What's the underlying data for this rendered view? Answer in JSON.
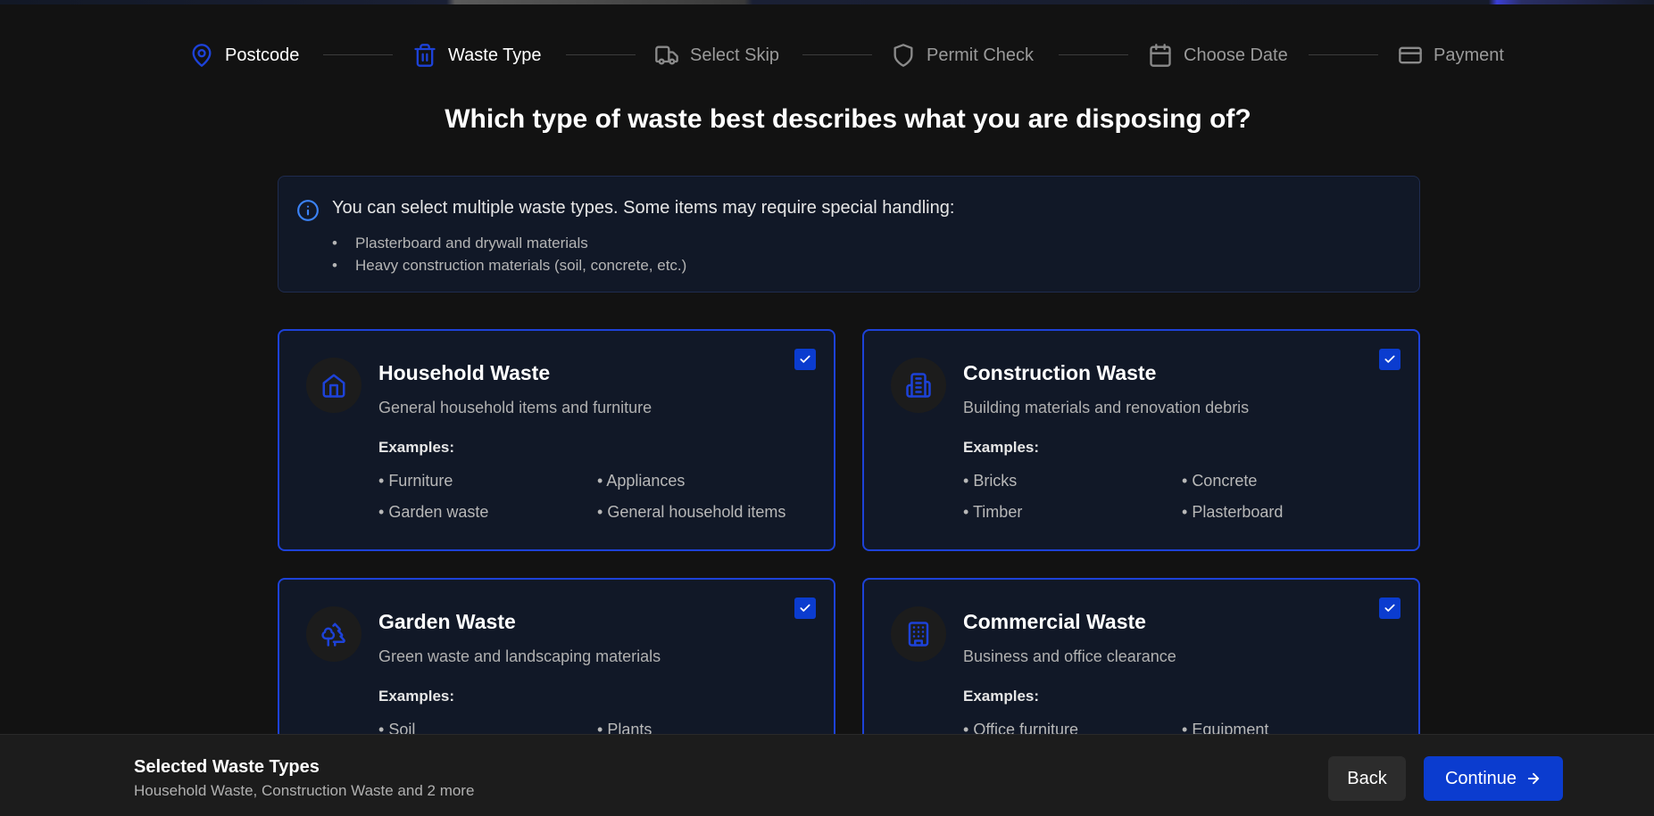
{
  "stepper": {
    "steps": [
      {
        "label": "Postcode",
        "icon": "map-pin-icon",
        "state": "active"
      },
      {
        "label": "Waste Type",
        "icon": "trash-icon",
        "state": "active"
      },
      {
        "label": "Select Skip",
        "icon": "truck-icon",
        "state": "inactive"
      },
      {
        "label": "Permit Check",
        "icon": "shield-icon",
        "state": "inactive"
      },
      {
        "label": "Choose Date",
        "icon": "calendar-icon",
        "state": "inactive"
      },
      {
        "label": "Payment",
        "icon": "credit-card-icon",
        "state": "inactive"
      }
    ]
  },
  "question": "Which type of waste best describes what you are disposing of?",
  "info": {
    "text": "You can select multiple waste types. Some items may require special handling:",
    "items": [
      "Plasterboard and drywall materials",
      "Heavy construction materials (soil, concrete, etc.)"
    ]
  },
  "cards": [
    {
      "title": "Household Waste",
      "description": "General household items and furniture",
      "examples_label": "Examples:",
      "examples": [
        "Furniture",
        "Appliances",
        "Garden waste",
        "General household items"
      ],
      "selected": true,
      "icon": "house-icon"
    },
    {
      "title": "Construction Waste",
      "description": "Building materials and renovation debris",
      "examples_label": "Examples:",
      "examples": [
        "Bricks",
        "Concrete",
        "Timber",
        "Plasterboard"
      ],
      "selected": true,
      "icon": "building-icon"
    },
    {
      "title": "Garden Waste",
      "description": "Green waste and landscaping materials",
      "examples_label": "Examples:",
      "examples": [
        "Soil",
        "Plants"
      ],
      "selected": true,
      "icon": "trees-icon"
    },
    {
      "title": "Commercial Waste",
      "description": "Business and office clearance",
      "examples_label": "Examples:",
      "examples": [
        "Office furniture",
        "Equipment"
      ],
      "selected": true,
      "icon": "office-building-icon"
    }
  ],
  "footer": {
    "selected_title": "Selected Waste Types",
    "selected_summary": "Household Waste, Construction Waste and 2 more",
    "back_label": "Back",
    "continue_label": "Continue"
  },
  "colors": {
    "accent": "#0b3ccf",
    "active_icon": "#1d42d8",
    "background": "#121212",
    "card_bg": "#111827"
  }
}
